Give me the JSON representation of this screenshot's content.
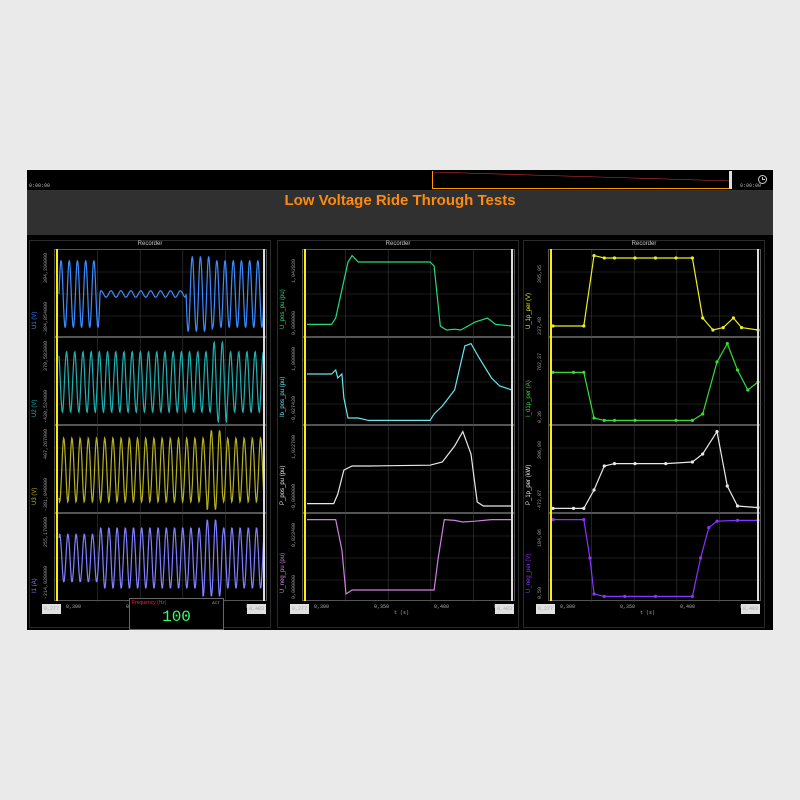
{
  "timeline": {
    "start": "0:00:00",
    "end": "0:00:00"
  },
  "title": "Low Voltage Ride Through Tests",
  "panel_title": "Recorder",
  "colors": {
    "title": "#ff8a10",
    "background": "#000000"
  },
  "panels": [
    {
      "x_start": "0,277",
      "x_end": "0,483",
      "x_unit": "",
      "x_ticks": [
        "0,300",
        "0,350",
        "0,400",
        "0,450"
      ],
      "plots": [
        {
          "label": "U1 (V)",
          "color": "#3d8cff",
          "ticks": [
            "-384,854000",
            "394,290000"
          ]
        },
        {
          "label": "U2 (V)",
          "color": "#20b0b0",
          "ticks": [
            "-430,524000",
            "370,583000"
          ]
        },
        {
          "label": "U3 (V)",
          "color": "#b5b020",
          "ticks": [
            "-381,848000",
            "407,267000"
          ]
        },
        {
          "label": "I1 (A)",
          "color": "#8080ff",
          "ticks": [
            "-214,939000",
            "255,170000"
          ]
        }
      ]
    },
    {
      "x_start": "0,277",
      "x_end": "0,483",
      "x_unit": "t (s)",
      "x_ticks": [
        "0,300",
        "0,350",
        "0,400",
        "0,450"
      ],
      "plots": [
        {
          "label": "U_pos_pu (pu)",
          "color": "#22dd77",
          "ticks": [
            "0,000000",
            "1,042830"
          ]
        },
        {
          "label": "Ib_pos_pu (pu)",
          "color": "#66e6ee",
          "ticks": [
            "-0,027430",
            "1,000000"
          ]
        },
        {
          "label": "P_pos_pu (pu)",
          "color": "#e8e8e8",
          "ticks": [
            "-0,000000",
            "1,022700"
          ]
        },
        {
          "label": "U_neg_pu (pu)",
          "color": "#d080e0",
          "ticks": [
            "0,000000",
            "0,823400"
          ]
        }
      ]
    },
    {
      "x_start": "0,277",
      "x_end": "0,483",
      "x_unit": "t (s)",
      "x_ticks": [
        "0,300",
        "0,350",
        "0,400",
        "0,450"
      ],
      "plots": [
        {
          "label": "U_1p_per (V)",
          "color": "#eeee22",
          "ticks": [
            "237,48",
            "395,05"
          ]
        },
        {
          "label": "I_d1p_per (A)",
          "color": "#33dd33",
          "ticks": [
            "0,36",
            "762,37"
          ]
        },
        {
          "label": "P_1p_per (kW)",
          "color": "#e8e8e8",
          "ticks": [
            "-472,87",
            "396,99"
          ]
        },
        {
          "label": "U_neg_per (V)",
          "color": "#8833ff",
          "ticks": [
            "0,50",
            "184,06"
          ]
        }
      ]
    }
  ],
  "frequency": {
    "label": "Frequency (Hz)",
    "act": "ACT",
    "value": "100"
  }
}
